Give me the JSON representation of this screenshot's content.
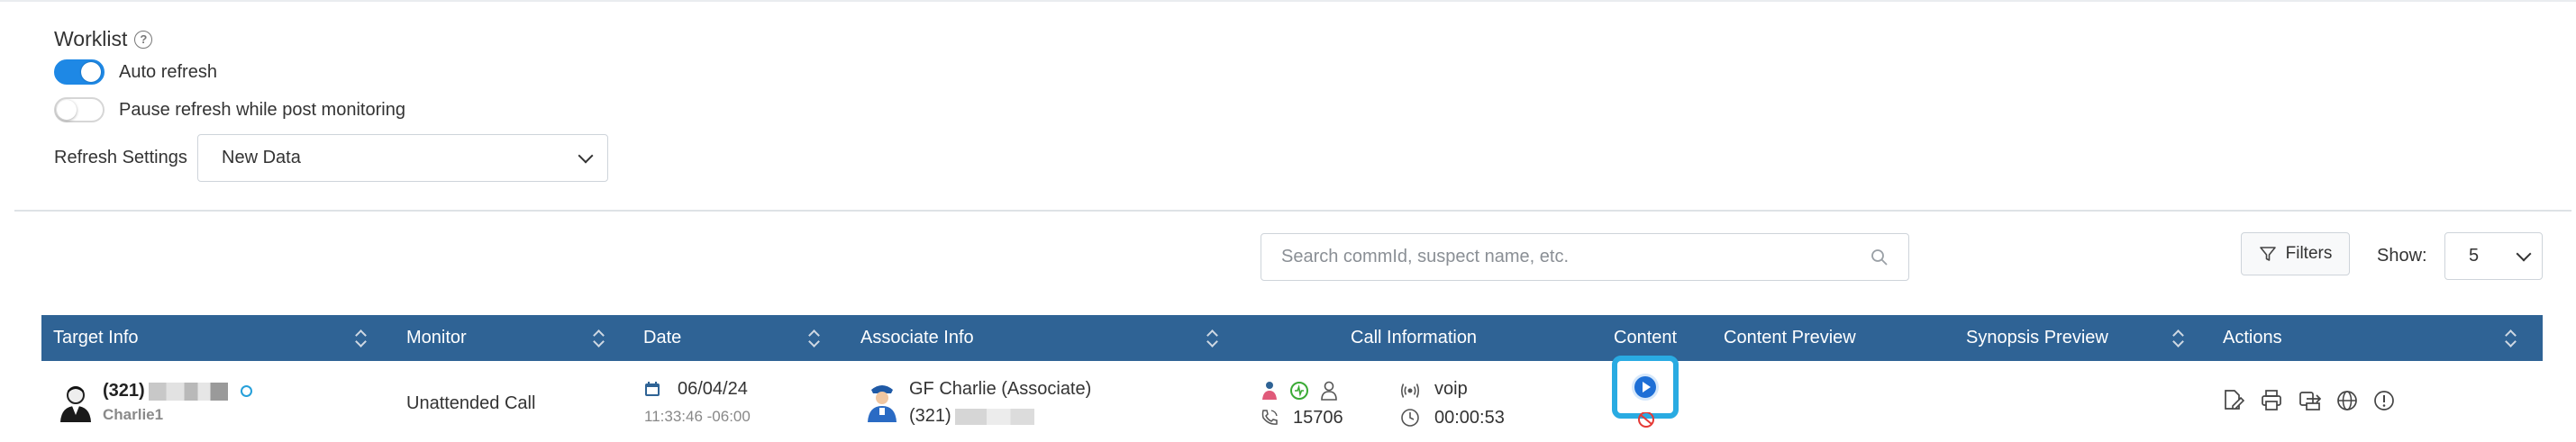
{
  "worklist": {
    "title": "Worklist",
    "help_icon": "question-circle-icon",
    "auto_refresh": {
      "label": "Auto refresh",
      "checked": true
    },
    "pause_refresh": {
      "label": "Pause refresh while post monitoring",
      "checked": false
    },
    "refresh_settings": {
      "label": "Refresh Settings",
      "value": "New Data"
    }
  },
  "toolbar": {
    "search_placeholder": "Search commId, suspect name, etc.",
    "filters_label": "Filters",
    "show_label": "Show:",
    "show_value": "5"
  },
  "table": {
    "columns": [
      "Target Info",
      "Monitor",
      "Date",
      "Associate Info",
      "Call Information",
      "Content",
      "Content Preview",
      "Synopsis Preview",
      "Actions"
    ],
    "row": {
      "target_number": "(321)",
      "target_name": "Charlie1",
      "monitor": "Unattended Call",
      "date": "06/04/24",
      "time": "11:33:46 -06:00",
      "associate_name": "GF Charlie (Associate)",
      "associate_number": "(321)",
      "call_type": "voip",
      "call_id": "15706",
      "duration": "00:00:53"
    }
  },
  "colors": {
    "header_bg": "#2f6395",
    "accent": "#1e88e5",
    "highlight": "#29abe2"
  }
}
